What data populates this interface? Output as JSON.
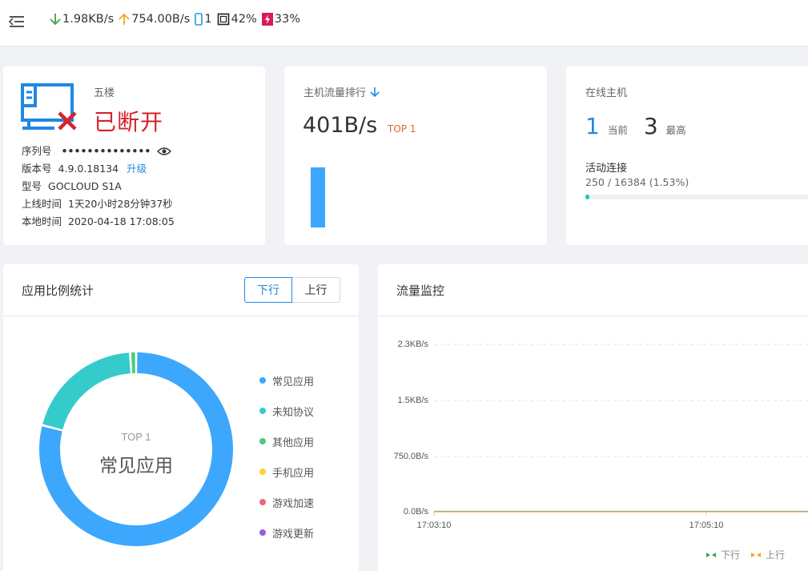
{
  "topbar": {
    "download_speed": "1.98KB/s",
    "upload_speed": "754.00B/s",
    "devices_count": "1",
    "cpu": "42%",
    "memory": "33%"
  },
  "device": {
    "name": "五楼",
    "status": "已断开",
    "serial_label": "序列号",
    "serial_value": "••••••••••••••",
    "version_label": "版本号",
    "version_value": "4.9.0.18134",
    "upgrade_link": "升级",
    "model_label": "型号",
    "model_value": "GOCLOUD S1A",
    "uptime_label": "上线时间",
    "uptime_value": "1天20小时28分钟37秒",
    "localtime_label": "本地时间",
    "localtime_value": "2020-04-18 17:08:05"
  },
  "flow_rank": {
    "title": "主机流量排行",
    "value": "401B/s",
    "badge": "TOP 1"
  },
  "online": {
    "title": "在线主机",
    "current_value": "1",
    "current_label": "当前",
    "max_value": "3",
    "max_label": "最高",
    "conn_title": "活动连接",
    "conn_value": "250 / 16384 (1.53%)",
    "conn_fraction": 0.0153
  },
  "app_stats": {
    "title": "应用比例统计",
    "tab_down": "下行",
    "tab_up": "上行",
    "center_label": "TOP 1",
    "center_name": "常见应用",
    "legend": [
      {
        "name": "常见应用",
        "color": "#3da7fd"
      },
      {
        "name": "未知协议",
        "color": "#36cbcb"
      },
      {
        "name": "其他应用",
        "color": "#4ecb73"
      },
      {
        "name": "手机应用",
        "color": "#fbd437"
      },
      {
        "name": "游戏加速",
        "color": "#f2637b"
      },
      {
        "name": "游戏更新",
        "color": "#975fe5"
      }
    ]
  },
  "chart_data": [
    {
      "type": "pie",
      "categories": [
        "常见应用",
        "未知协议",
        "其他应用",
        "手机应用",
        "游戏加速",
        "游戏更新"
      ],
      "values": [
        79,
        20,
        1,
        0,
        0,
        0
      ],
      "colors": [
        "#3da7fd",
        "#36cbcb",
        "#4ecb73",
        "#fbd437",
        "#f2637b",
        "#975fe5"
      ]
    },
    {
      "type": "line",
      "title": "流量监控",
      "x": [
        "17:03:10",
        "17:05:10"
      ],
      "y_ticks": [
        "2.3KB/s",
        "1.5KB/s",
        "750.0B/s",
        "0.0B/s"
      ],
      "series": [
        {
          "name": "下行",
          "color": "#3da7fd",
          "values": [
            0,
            0
          ]
        },
        {
          "name": "上行",
          "color": "#f5a623",
          "values": [
            0,
            0
          ]
        }
      ],
      "grid": true,
      "legend": "bottom-right"
    }
  ],
  "monitor": {
    "title": "流量监控",
    "y_ticks": [
      "2.3KB/s",
      "1.5KB/s",
      "750.0B/s",
      "0.0B/s"
    ],
    "x_ticks": [
      "17:03:10",
      "17:05:10"
    ],
    "legend_down": "下行",
    "legend_up": "上行"
  }
}
